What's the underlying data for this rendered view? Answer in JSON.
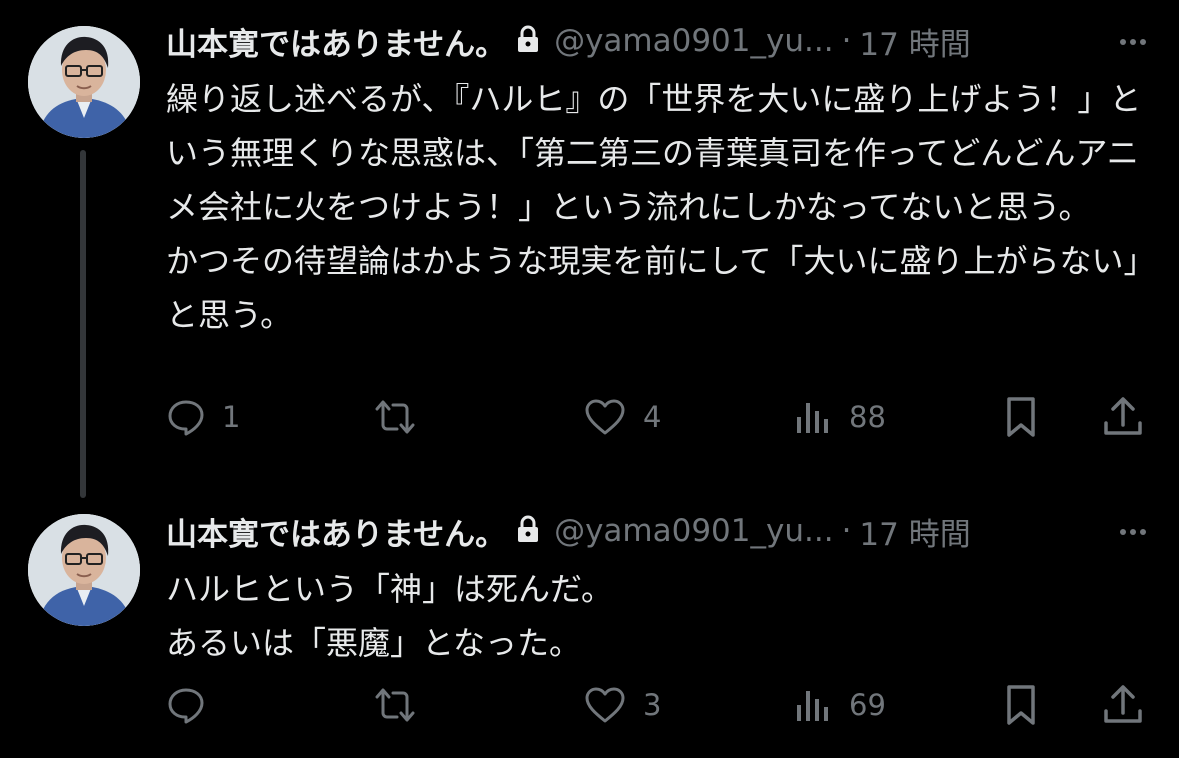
{
  "colors": {
    "background": "#000000",
    "primary_text": "#e7e9ea",
    "secondary_text": "#71767b",
    "thread_line": "#333639"
  },
  "tweets": [
    {
      "display_name": "山本寛ではありません。",
      "handle": "@yama0901_yu...",
      "separator": "·",
      "time": "17 時間",
      "body": "繰り返し述べるが、『ハルヒ』の「世界を大いに盛り上げよう！」という無理くりな思惑は、「第二第三の青葉真司を作ってどんどんアニメ会社に火をつけよう！」という流れにしかなってないと思う。\nかつその待望論はかような現実を前にして「大いに盛り上がらない」と思う。",
      "replies": "1",
      "reposts": "",
      "likes": "4",
      "views": "88"
    },
    {
      "display_name": "山本寛ではありません。",
      "handle": "@yama0901_yu...",
      "separator": "·",
      "time": "17 時間",
      "body": "ハルヒという「神」は死んだ。\nあるいは「悪魔」となった。",
      "replies": "",
      "reposts": "",
      "likes": "3",
      "views": "69"
    }
  ],
  "icons": {
    "lock": "lock-icon",
    "more": "more-icon",
    "reply": "reply-icon",
    "repost": "repost-icon",
    "like": "heart-icon",
    "views": "views-icon",
    "bookmark": "bookmark-icon",
    "share": "share-icon"
  }
}
